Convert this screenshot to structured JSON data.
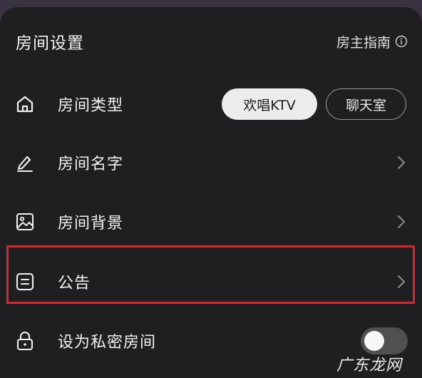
{
  "header": {
    "title": "房间设置",
    "guide_label": "房主指南"
  },
  "rows": [
    {
      "label": "房间类型",
      "icon": "home-icon",
      "options": [
        {
          "label": "欢唱KTV",
          "selected": true
        },
        {
          "label": "聊天室",
          "selected": false
        }
      ]
    },
    {
      "label": "房间名字",
      "icon": "pen-icon"
    },
    {
      "label": "房间背景",
      "icon": "image-icon"
    },
    {
      "label": "公告",
      "icon": "notice-icon",
      "highlighted": true
    },
    {
      "label": "设为私密房间",
      "icon": "lock-icon",
      "toggle_on": false
    }
  ],
  "watermark": "广东龙网",
  "colors": {
    "sheet_bg": "#1f1f21",
    "highlight_border": "#d8272d",
    "selected_pill_bg": "#ececec"
  }
}
